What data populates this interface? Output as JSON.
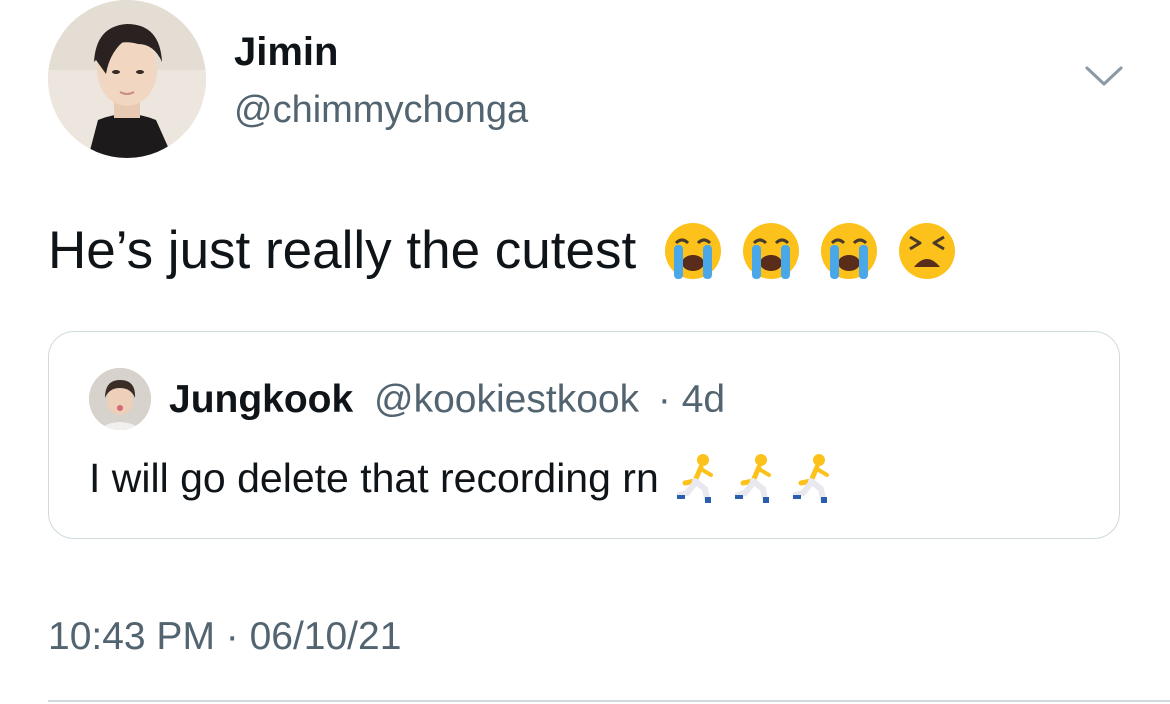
{
  "tweet": {
    "author_name": "Jimin",
    "author_handle": "@chimmychonga",
    "text": "He’s just really the cutest",
    "emojis": [
      "loudly-crying-face-emoji",
      "loudly-crying-face-emoji",
      "loudly-crying-face-emoji",
      "tired-face-emoji"
    ],
    "timestamp": "10:43 PM · 06/10/21"
  },
  "quoted_tweet": {
    "author_name": "Jungkook",
    "author_handle": "@kookiestkook",
    "age": "· 4d",
    "text": "I will go delete that recording rn",
    "emojis": [
      "person-running-emoji",
      "person-running-emoji",
      "person-running-emoji"
    ]
  },
  "icons": {
    "menu": "chevron-down-icon"
  },
  "colors": {
    "text_primary": "#0f1419",
    "text_secondary": "#536471",
    "border": "#cfd9de"
  }
}
